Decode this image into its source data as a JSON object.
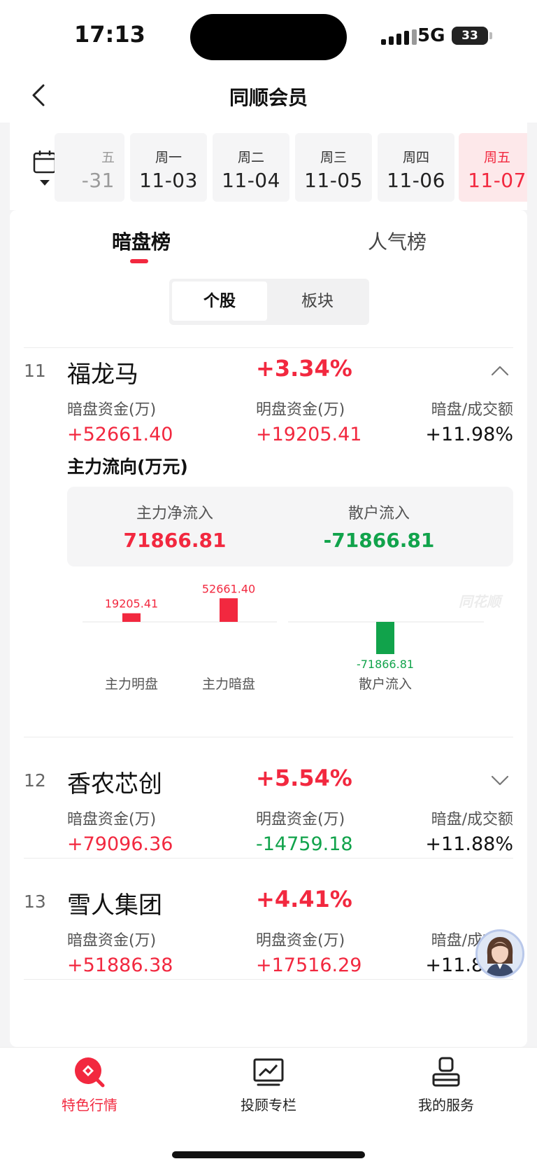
{
  "status_bar": {
    "time": "17:13",
    "network": "5G",
    "battery": "33"
  },
  "nav": {
    "title": "同顺会员"
  },
  "dates": [
    {
      "weekday": "五",
      "date": "-31",
      "state": "partial"
    },
    {
      "weekday": "周一",
      "date": "11-03"
    },
    {
      "weekday": "周二",
      "date": "11-04"
    },
    {
      "weekday": "周三",
      "date": "11-05"
    },
    {
      "weekday": "周四",
      "date": "11-06"
    },
    {
      "weekday": "周五",
      "date": "11-07",
      "state": "active"
    }
  ],
  "tabs": {
    "dark_pool": "暗盘榜",
    "popularity": "人气榜",
    "active": "暗盘榜"
  },
  "segment": {
    "stocks": "个股",
    "sectors": "板块",
    "active": "个股"
  },
  "columns": {
    "dark": "暗盘资金(万)",
    "lit": "明盘资金(万)",
    "ratio": "暗盘/成交额"
  },
  "stocks": [
    {
      "rank": "11",
      "name": "福龙马",
      "change": "+3.34%",
      "dark": "+52661.40",
      "lit": "+19205.41",
      "ratio": "+11.98%",
      "expanded": true,
      "flow": {
        "title": "主力流向(万元)",
        "main_net_label": "主力净流入",
        "main_net": "71866.81",
        "retail_label": "散户流入",
        "retail": "-71866.81"
      }
    },
    {
      "rank": "12",
      "name": "香农芯创",
      "change": "+5.54%",
      "dark": "+79096.36",
      "lit": "-14759.18",
      "ratio": "+11.88%",
      "expanded": false
    },
    {
      "rank": "13",
      "name": "雪人集团",
      "change": "+4.41%",
      "dark": "+51886.38",
      "lit": "+17516.29",
      "ratio": "+11.86%",
      "expanded": false
    }
  ],
  "chart_data": {
    "type": "bar",
    "categories": [
      "主力明盘",
      "主力暗盘",
      "散户流入"
    ],
    "values": [
      19205.41,
      52661.4,
      -71866.81
    ],
    "labels": [
      "19205.41",
      "52661.40",
      "-71866.81"
    ],
    "watermark": "同花顺",
    "colors": {
      "positive": "#f2283f",
      "negative": "#11a34b"
    }
  },
  "bottom_nav": [
    {
      "label": "特色行情",
      "icon": "special-market-icon",
      "active": true
    },
    {
      "label": "投顾专栏",
      "icon": "chart-column-icon"
    },
    {
      "label": "我的服务",
      "icon": "user-service-icon"
    }
  ],
  "colors": {
    "accent": "#f2283f",
    "up": "#f2283f",
    "down": "#11a34b"
  }
}
